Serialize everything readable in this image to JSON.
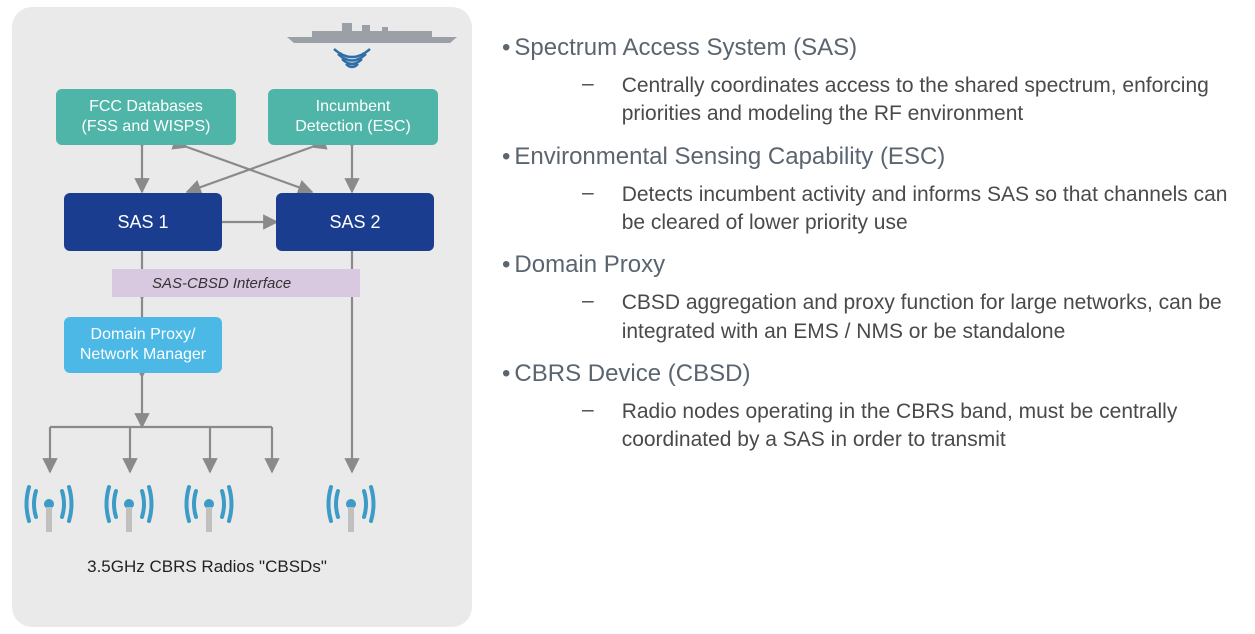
{
  "diagram": {
    "fcc": "FCC Databases\n(FSS and WISPS)",
    "esc": "Incumbent\nDetection (ESC)",
    "sas1": "SAS 1",
    "sas2": "SAS 2",
    "interface": "SAS-CBSD Interface",
    "proxy": "Domain Proxy/\nNetwork Manager",
    "caption": "3.5GHz CBRS Radios \"CBSDs\""
  },
  "text": {
    "h1": "Spectrum Access System (SAS)",
    "d1": "Centrally coordinates access to the shared spectrum, enforcing priorities and modeling the RF environment",
    "h2": "Environmental Sensing Capability (ESC)",
    "d2": "Detects incumbent activity and informs SAS so that channels can be cleared of lower priority use",
    "h3": "Domain Proxy",
    "d3": "CBSD aggregation and proxy function for large networks, can be integrated with an EMS / NMS or be standalone",
    "h4": "CBRS Device (CBSD)",
    "d4": "Radio nodes operating in the CBRS band, must be centrally coordinated by a SAS in order to transmit"
  }
}
